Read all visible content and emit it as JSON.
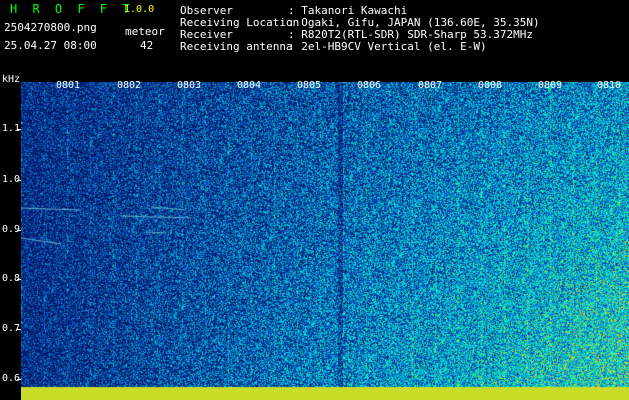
{
  "header": {
    "brand": "H R O F F T",
    "version": "1.0.0",
    "filename": "2504270800.png",
    "datetime": "25.04.27 08:00",
    "meteor_label": "meteor",
    "meteor_count": "42"
  },
  "info": [
    {
      "label": "Observer",
      "value": ": Takanori Kawachi"
    },
    {
      "label": "Receiving Location",
      "value": ": Ogaki, Gifu, JAPAN (136.60E, 35.35N)"
    },
    {
      "label": "Receiver",
      "value": ": R820T2(RTL-SDR) SDR-Sharp 53.372MHz"
    },
    {
      "label": "Receiving antenna",
      "value": ": 2el-HB9CV Vertical (el. E-W)"
    }
  ],
  "axis": {
    "y_unit": "kHz",
    "y_ticks": [
      "1.1",
      "1.0",
      "0.9",
      "0.8",
      "0.7",
      "0.6"
    ],
    "x_ticks": [
      "0801",
      "0802",
      "0803",
      "0804",
      "0805",
      "0806",
      "0807",
      "0808",
      "0809",
      "0810"
    ]
  },
  "colors": {
    "brand": "#00ff00",
    "version": "#ffff00",
    "text": "#ffffff",
    "background": "#000000",
    "noise_floor": "#06186e"
  }
}
